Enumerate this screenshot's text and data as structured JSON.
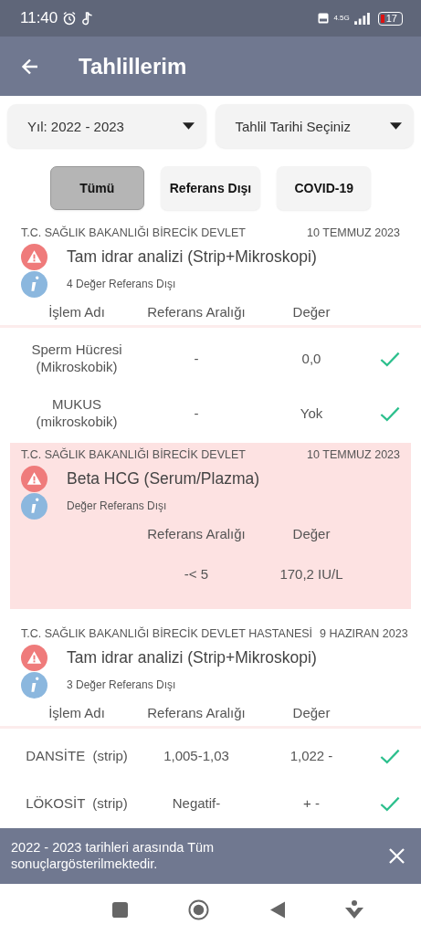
{
  "status_bar": {
    "time": "11:40",
    "network": "4.5G",
    "battery": "17"
  },
  "app_bar": {
    "title": "Tahlillerim"
  },
  "filters": [
    {
      "label": "Yıl: 2022 - 2023"
    },
    {
      "label": "Tahlil Tarihi Seçiniz"
    }
  ],
  "chips": [
    {
      "label": "Tümü",
      "selected": true
    },
    {
      "label": "Referans Dışı",
      "selected": false
    },
    {
      "label": "COVID-19",
      "selected": false
    }
  ],
  "results": [
    {
      "institution": "T.C. SAĞLIK BAKANLIĞI BİRECİK DEVLET",
      "date": "10 TEMMUZ 2023",
      "test": "Tam idrar analizi (Strip+Mikroskopi)",
      "note": "4 Değer Referans Dışı",
      "highlighted": false,
      "columns": {
        "name": "İşlem Adı",
        "reference": "Referans Aralığı",
        "value": "Değer"
      },
      "rows": [
        {
          "name": "Sperm Hücresi (Mikroskobik)",
          "reference": "-",
          "value": "0,0",
          "ok": true
        },
        {
          "name": "MUKUS (mikroskobik)",
          "reference": "-",
          "value": "Yok",
          "ok": true
        }
      ]
    },
    {
      "institution": "T.C. SAĞLIK BAKANLIĞI BİRECİK DEVLET",
      "date": "10 TEMMUZ 2023",
      "test": "Beta HCG (Serum/Plazma)",
      "note": "Değer Referans Dışı",
      "highlighted": true,
      "columns": {
        "reference": "Referans Aralığı",
        "value": "Değer"
      },
      "rows": [
        {
          "reference": "-< 5",
          "value": "170,2 IU/L",
          "ok": false
        }
      ]
    },
    {
      "institution": "T.C. SAĞLIK BAKANLIĞI BİRECİK DEVLET HASTANESİ",
      "date": "9 HAZIRAN 2023",
      "test": "Tam idrar analizi (Strip+Mikroskopi)",
      "note": "3 Değer Referans Dışı",
      "highlighted": false,
      "columns": {
        "name": "İşlem Adı",
        "reference": "Referans Aralığı",
        "value": "Değer"
      },
      "rows": [
        {
          "name": "DANSİTE  (strip)",
          "reference": "1,005-1,03",
          "value": "1,022 -",
          "ok": true
        },
        {
          "name": "LÖKOSİT  (strip)",
          "reference": "Negatif-",
          "value": "+ -",
          "ok": true
        }
      ]
    }
  ],
  "snackbar": {
    "message": "2022 - 2023 tarihleri arasında Tüm sonuçlargösterilmektedir."
  }
}
